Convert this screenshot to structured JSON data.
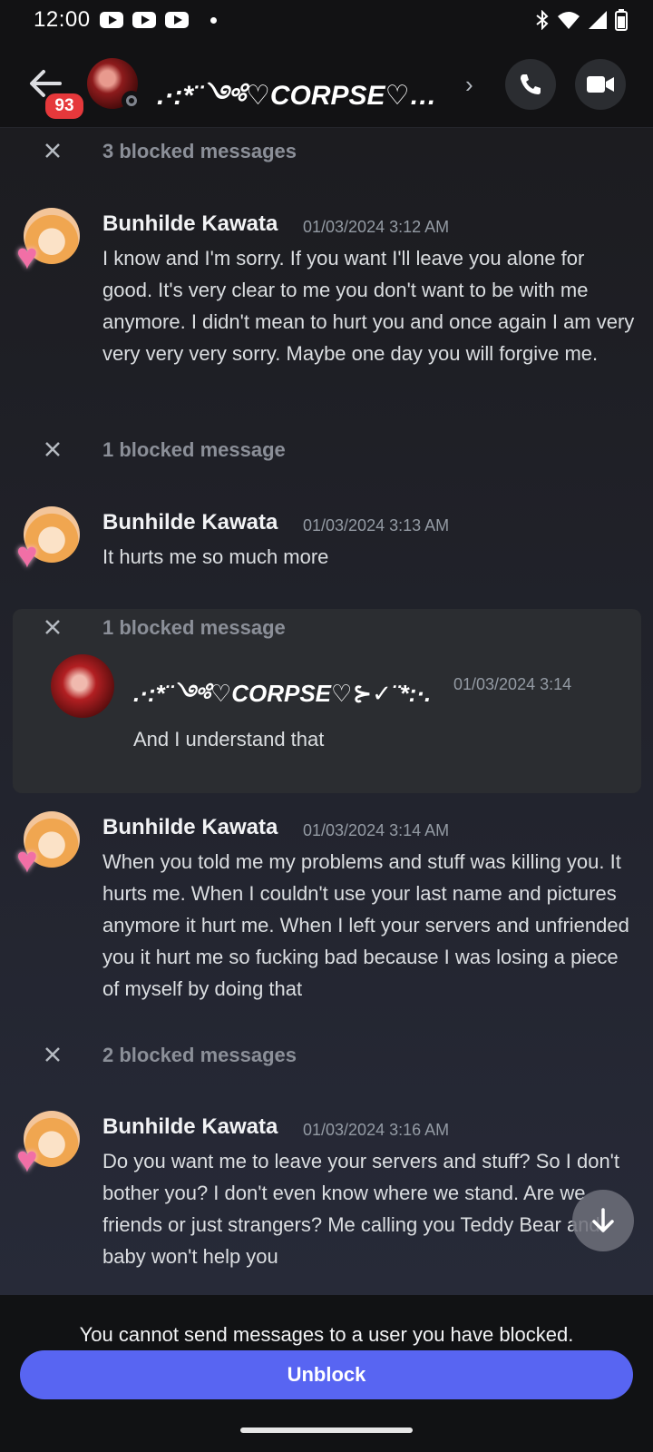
{
  "status_bar": {
    "time": "12:00"
  },
  "header": {
    "unread_badge": "93",
    "title": ".·:*¨༺♡CORPSE♡…",
    "chevron": "›"
  },
  "chat": {
    "blocked_rows": [
      {
        "text": "3 blocked messages"
      },
      {
        "text": "1 blocked message"
      },
      {
        "text": "2 blocked messages"
      }
    ],
    "messages": [
      {
        "author": "Bunhilde Kawata",
        "timestamp": "01/03/2024 3:12 AM",
        "text": "I know and I'm sorry. If you want I'll leave you alone for good. It's very clear to me you don't want to be with me anymore. I didn't mean to hurt you and once again I am very very very very sorry. Maybe one day you will forgive me."
      },
      {
        "author": "Bunhilde Kawata",
        "timestamp": "01/03/2024 3:13 AM",
        "text": "It hurts me so much more"
      },
      {
        "author": "Bunhilde Kawata",
        "timestamp": "01/03/2024 3:14 AM",
        "text": "When you told me my problems and stuff was killing you. It hurts me. When I couldn't use your last name and pictures anymore it hurt me. When I left your servers and unfriended you it hurt me so fucking bad because I was losing a piece of myself by doing that"
      },
      {
        "author": "Bunhilde Kawata",
        "timestamp": "01/03/2024 3:16 AM",
        "text": "Do you want me to leave your servers and stuff? So I don't bother you? I don't even know where we stand. Are we friends or just strangers? Me calling you Teddy Bear and baby won't help you"
      }
    ],
    "expanded_blocked": {
      "label": "1 blocked message",
      "author": ".·:*¨༺♡CORPSE♡⊱✓¨*:·.",
      "timestamp": "01/03/2024 3:14",
      "text": "And I understand that"
    }
  },
  "footer": {
    "notice": "You cannot send messages to a user you have blocked.",
    "unblock_label": "Unblock"
  },
  "colors": {
    "accent": "#5865f2",
    "badge": "#e5383b"
  }
}
